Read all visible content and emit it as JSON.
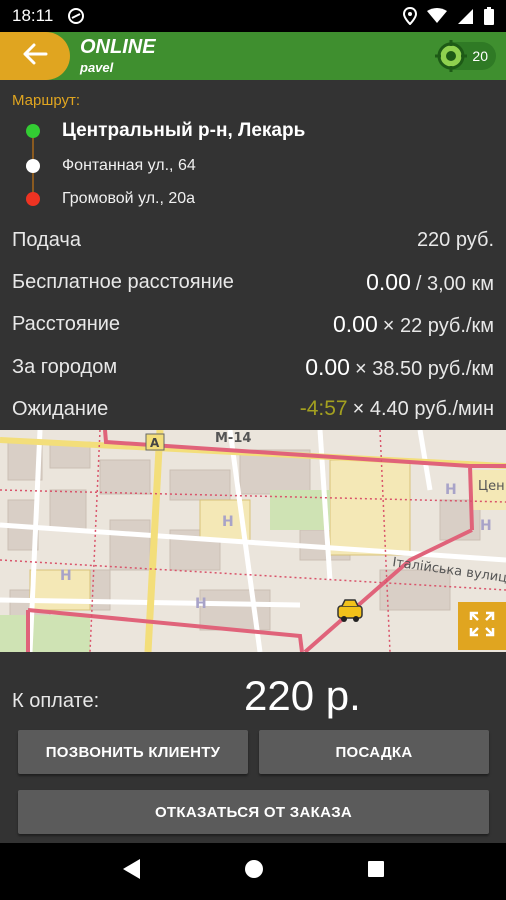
{
  "status_bar": {
    "time": "18:11",
    "icons": [
      "android-circle-icon",
      "location-icon",
      "wifi-icon",
      "signal-icon",
      "battery-icon"
    ]
  },
  "app_bar": {
    "title": "ONLINE",
    "subtitle": "pavel",
    "gps_count": "20",
    "colors": {
      "bar": "#3f8f2f",
      "accent": "#e0a520"
    }
  },
  "route": {
    "heading": "Маршрут:",
    "stops": [
      {
        "label": "Центральный р-н, Лекарь",
        "color": "#33cc33"
      },
      {
        "label": "Фонтанная ул., 64",
        "color": "#ffffff"
      },
      {
        "label": "Громовой ул., 20а",
        "color": "#ee3322"
      }
    ]
  },
  "fare": {
    "pickup": {
      "label": "Подача",
      "value": "220 руб."
    },
    "free_distance": {
      "label": "Бесплатное расстояние",
      "value": "0.00",
      "unit": "/ 3,00 км"
    },
    "distance": {
      "label": "Расстояние",
      "value": "0.00",
      "unit": "× 22 руб./км"
    },
    "outside_city": {
      "label": "За городом",
      "value": "0.00",
      "unit": "× 38.50 руб./км"
    },
    "waiting": {
      "label": "Ожидание",
      "value": "-4:57",
      "unit": "× 4.40 руб./мин"
    }
  },
  "map": {
    "labels": {
      "road": "М-14",
      "road_marker": "А",
      "street": "Італійська вулиц",
      "area": "Цен"
    }
  },
  "payment": {
    "label": "К оплате:",
    "amount": "220 р."
  },
  "actions": {
    "call_client": "ПОЗВОНИТЬ КЛИЕНТУ",
    "boarding": "ПОСАДКА",
    "cancel_order": "ОТКАЗАТЬСЯ ОТ ЗАКАЗА"
  }
}
